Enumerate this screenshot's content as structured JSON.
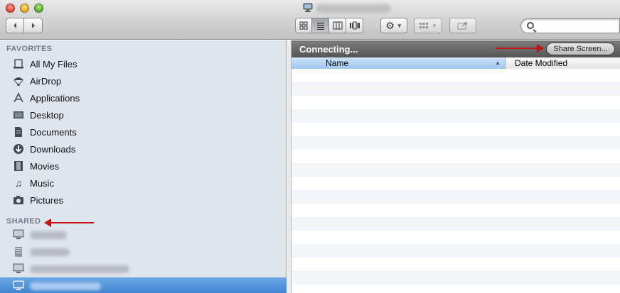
{
  "window": {
    "title_icon": "computer-icon"
  },
  "toolbar": {
    "back_icon": "chevron-left-icon",
    "forward_icon": "chevron-right-icon",
    "views": [
      {
        "icon": "icon-view-icon",
        "active": false
      },
      {
        "icon": "list-view-icon",
        "active": true
      },
      {
        "icon": "column-view-icon",
        "active": false
      },
      {
        "icon": "coverflow-view-icon",
        "active": false
      }
    ],
    "action_icon": "gear-icon",
    "arrange_icon": "arrange-grid-icon",
    "share_icon": "share-icon",
    "search": {
      "placeholder": "",
      "value": ""
    }
  },
  "sidebar": {
    "favorites_header": "FAVORITES",
    "favorites": [
      {
        "label": "All My Files",
        "icon": "all-files-icon"
      },
      {
        "label": "AirDrop",
        "icon": "airdrop-icon"
      },
      {
        "label": "Applications",
        "icon": "applications-icon"
      },
      {
        "label": "Desktop",
        "icon": "desktop-icon"
      },
      {
        "label": "Documents",
        "icon": "documents-icon"
      },
      {
        "label": "Downloads",
        "icon": "downloads-icon"
      },
      {
        "label": "Movies",
        "icon": "movies-icon"
      },
      {
        "label": "Music",
        "icon": "music-icon"
      },
      {
        "label": "Pictures",
        "icon": "pictures-icon"
      }
    ],
    "shared_header": "SHARED",
    "shared": [
      {
        "icon": "computer-icon",
        "selected": false
      },
      {
        "icon": "server-icon",
        "selected": false
      },
      {
        "icon": "computer-icon",
        "selected": false
      },
      {
        "icon": "computer-icon",
        "selected": true
      }
    ]
  },
  "content": {
    "status_text": "Connecting...",
    "share_screen_label": "Share Screen...",
    "columns": {
      "name": "Name",
      "date_modified": "Date Modified"
    }
  },
  "colors": {
    "annotation_arrow": "#c21414",
    "selection": "#3b82d1",
    "sidebar_bg": "#dfe5ed"
  }
}
